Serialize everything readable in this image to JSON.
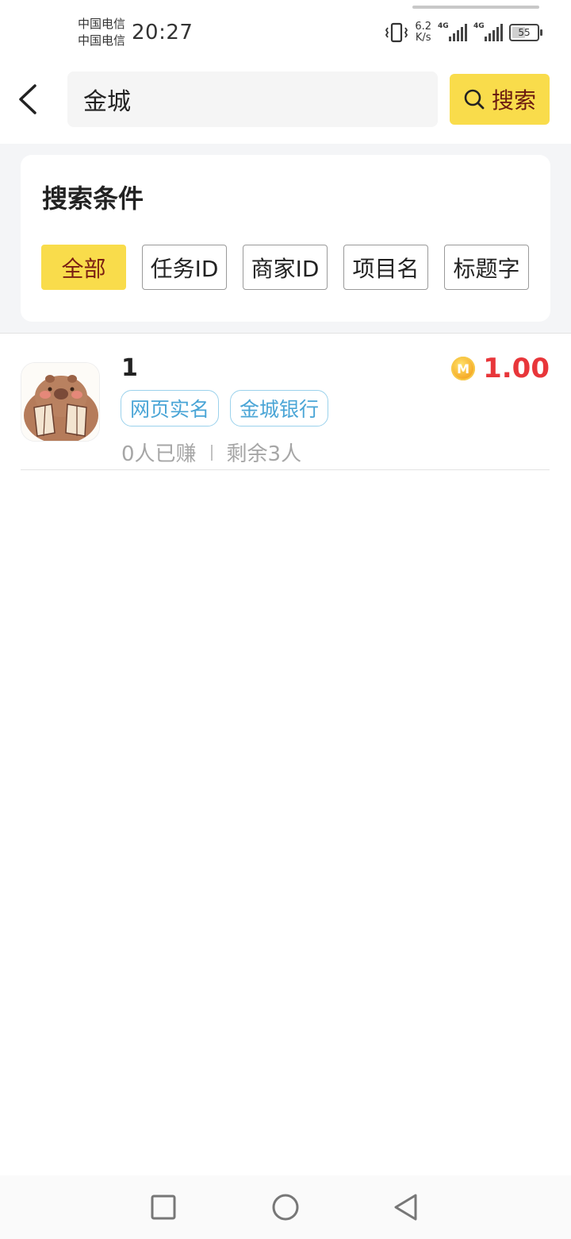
{
  "status_bar": {
    "carrier_1": "中国电信",
    "carrier_2": "中国电信",
    "time": "20:27",
    "speed_value": "6.2",
    "speed_unit": "K/s",
    "network_tag_1": "4G",
    "network_tag_2": "4G",
    "battery": "55"
  },
  "search": {
    "query": "金城",
    "button_label": "搜索"
  },
  "conditions": {
    "title": "搜索条件",
    "options": [
      "全部",
      "任务ID",
      "商家ID",
      "项目名",
      "标题字"
    ],
    "selected": "全部"
  },
  "tasks": [
    {
      "title": "1",
      "reward": "1.00",
      "coin_letter": "M",
      "tags": [
        "网页实名",
        "金城银行"
      ],
      "earned": "0人已赚",
      "remaining": "剩余3人"
    }
  ],
  "colors": {
    "accent_yellow": "#f9dc4b",
    "reward_red": "#e8363a",
    "tag_blue": "#4aa5d6"
  },
  "icons": {
    "back": "chevron-left-icon",
    "search": "search-icon",
    "nav_recent": "square-icon",
    "nav_home": "circle-icon",
    "nav_back": "triangle-back-icon"
  }
}
